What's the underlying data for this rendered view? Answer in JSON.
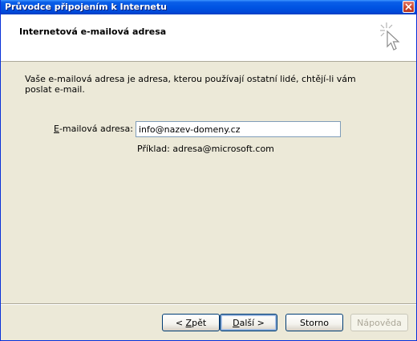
{
  "window": {
    "title": "Průvodce připojením k Internetu"
  },
  "header": {
    "title": "Internetová e-mailová adresa",
    "icon": "wizard-sparkle-cursor-icon"
  },
  "content": {
    "instructions": "Vaše e-mailová adresa je adresa, kterou používají ostatní lidé, chtějí-li vám poslat e-mail.",
    "email_label_accel": "E",
    "email_label_rest": "-mailová adresa:",
    "email_value": "info@nazev-domeny.cz",
    "example": "Příklad: adresa@microsoft.com"
  },
  "buttons": {
    "back_prefix": "< ",
    "back_accel": "Z",
    "back_rest": "pět",
    "next_accel": "D",
    "next_rest": "alší >",
    "cancel": "Storno",
    "help": "Nápověda"
  },
  "colors": {
    "titlebar": "#0054e3",
    "window_bg": "#ece9d8",
    "header_bg": "#ffffff",
    "close_button": "#c8432c"
  }
}
